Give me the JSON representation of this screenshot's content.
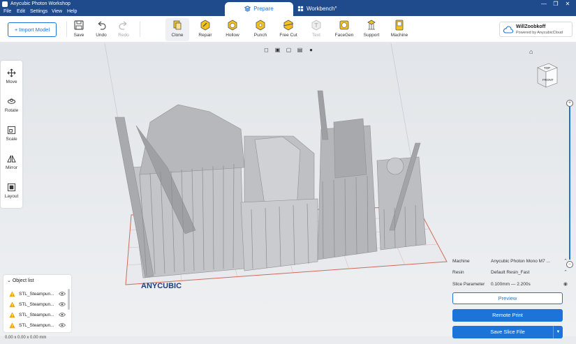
{
  "app": {
    "title": "Anycubic Photon Workshop",
    "menu": [
      "File",
      "Edit",
      "Settings",
      "View",
      "Help"
    ],
    "window_controls": [
      "—",
      "❒",
      "✕"
    ]
  },
  "tabs": {
    "prepare": "Prepare",
    "workbench": "Workbench",
    "workbench_badge": "°"
  },
  "toolbar": {
    "import": "+ Import Model",
    "save": "Save",
    "undo": "Undo",
    "redo": "Redo",
    "clone": "Clone",
    "repair": "Repair",
    "hollow": "Hollow",
    "punch": "Punch",
    "free_cut": "Free Cut",
    "text": "Text",
    "facegen": "FaceGen",
    "support": "Support",
    "machine": "Machine"
  },
  "account": {
    "name": "WillZoobkoff",
    "sub": "Powered by AnycubicCloud"
  },
  "side_tools": [
    "Move",
    "Rotate",
    "Scale",
    "Mirror",
    "Layout"
  ],
  "view_cube": {
    "top": "TOP",
    "front": "FRONT"
  },
  "plate_brand": "ANYCUBIC",
  "object_list": {
    "header": "Object list",
    "items": [
      "STL_Steampun...",
      "STL_Steampun...",
      "STL_Steampun...",
      "STL_Steampun..."
    ]
  },
  "dimensions": "0.00 x 0.00 x 0.00 mm",
  "slice": {
    "machine_label": "Machine",
    "machine_value": "Anycubic Photon Mono M7 ...",
    "resin_label": "Resin",
    "resin_value": "Default Resin_Fast",
    "param_label": "Slice Parameter",
    "param_value": "0.100mm  —  2.200s",
    "preview": "Preview",
    "remote_print": "Remote Print",
    "save_slice": "Save Slice File"
  },
  "colors": {
    "accent": "#1c74d9",
    "titlebar": "#1f4b8d",
    "warning": "#f0a500"
  }
}
